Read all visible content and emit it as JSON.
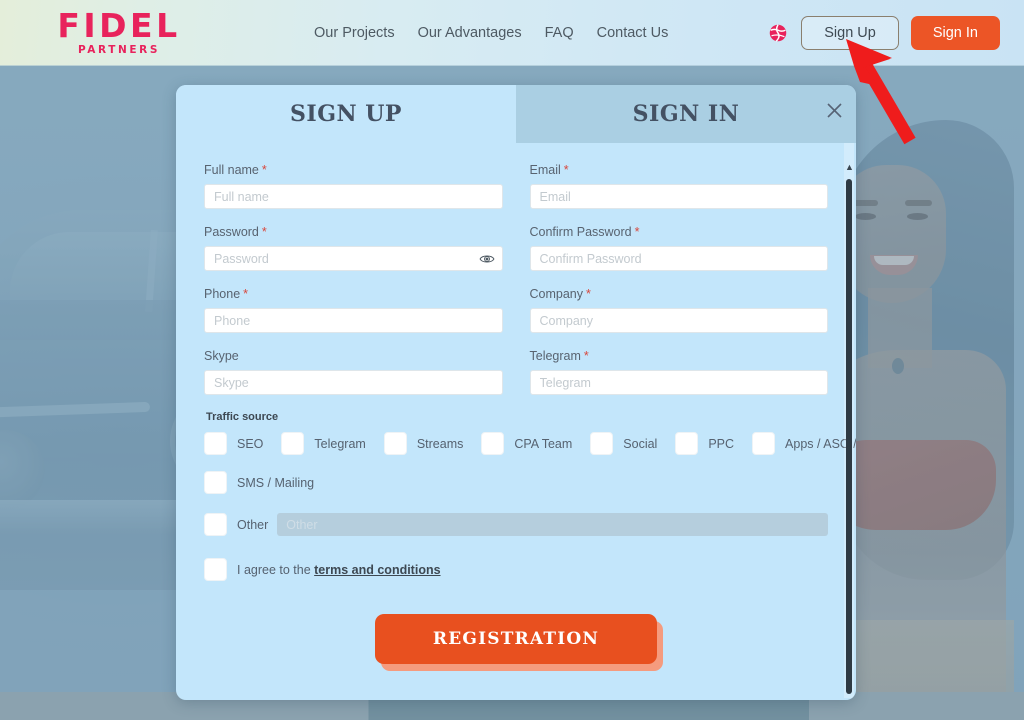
{
  "header": {
    "logo_main": "FIDEL",
    "logo_sub": "PARTNERS",
    "nav": [
      {
        "label": "Our Projects"
      },
      {
        "label": "Our Advantages"
      },
      {
        "label": "FAQ"
      },
      {
        "label": "Contact Us"
      }
    ],
    "language_icon": "globe-icon",
    "sign_up_label": "Sign Up",
    "sign_in_label": "Sign In",
    "accent_orange": "#ec5526",
    "brand_pink": "#e8235c"
  },
  "annotation": {
    "arrow_color": "#ef1c1c",
    "points_to": "Sign Up"
  },
  "modal": {
    "tab_sign_up": "Sign Up",
    "tab_sign_in": "Sign In",
    "active_tab": "Sign Up",
    "close_icon": "close-icon",
    "fields": {
      "full_name": {
        "label": "Full name",
        "required": "*",
        "placeholder": "Full name",
        "value": ""
      },
      "email": {
        "label": "Email",
        "required": "*",
        "placeholder": "Email",
        "value": ""
      },
      "password": {
        "label": "Password",
        "required": "*",
        "placeholder": "Password",
        "value": "",
        "toggle_icon": "eye-icon"
      },
      "confirm_password": {
        "label": "Confirm Password",
        "required": "*",
        "placeholder": "Confirm Password",
        "value": ""
      },
      "phone": {
        "label": "Phone",
        "required": "*",
        "placeholder": "Phone",
        "value": ""
      },
      "company": {
        "label": "Company",
        "required": "*",
        "placeholder": "Company",
        "value": ""
      },
      "skype": {
        "label": "Skype",
        "required": "",
        "placeholder": "Skype",
        "value": ""
      },
      "telegram": {
        "label": "Telegram",
        "required": "*",
        "placeholder": "Telegram",
        "value": ""
      }
    },
    "traffic_source": {
      "title": "Traffic source",
      "options_row1": [
        {
          "label": "SEO",
          "checked": false
        },
        {
          "label": "Telegram",
          "checked": false
        },
        {
          "label": "Streams",
          "checked": false
        },
        {
          "label": "CPA Team",
          "checked": false
        },
        {
          "label": "Social",
          "checked": false
        },
        {
          "label": "PPC",
          "checked": false
        },
        {
          "label": "Apps / ASO / UAC",
          "checked": false
        }
      ],
      "options_row2": [
        {
          "label": "SMS / Mailing",
          "checked": false
        }
      ],
      "other": {
        "label": "Other",
        "checked": false,
        "placeholder": "Other",
        "value": "",
        "disabled": true
      }
    },
    "agreement": {
      "prefix": "I agree to the ",
      "link": "terms and conditions",
      "checked": false
    },
    "submit_label": "Registration",
    "submit_color": "#e8501f"
  }
}
